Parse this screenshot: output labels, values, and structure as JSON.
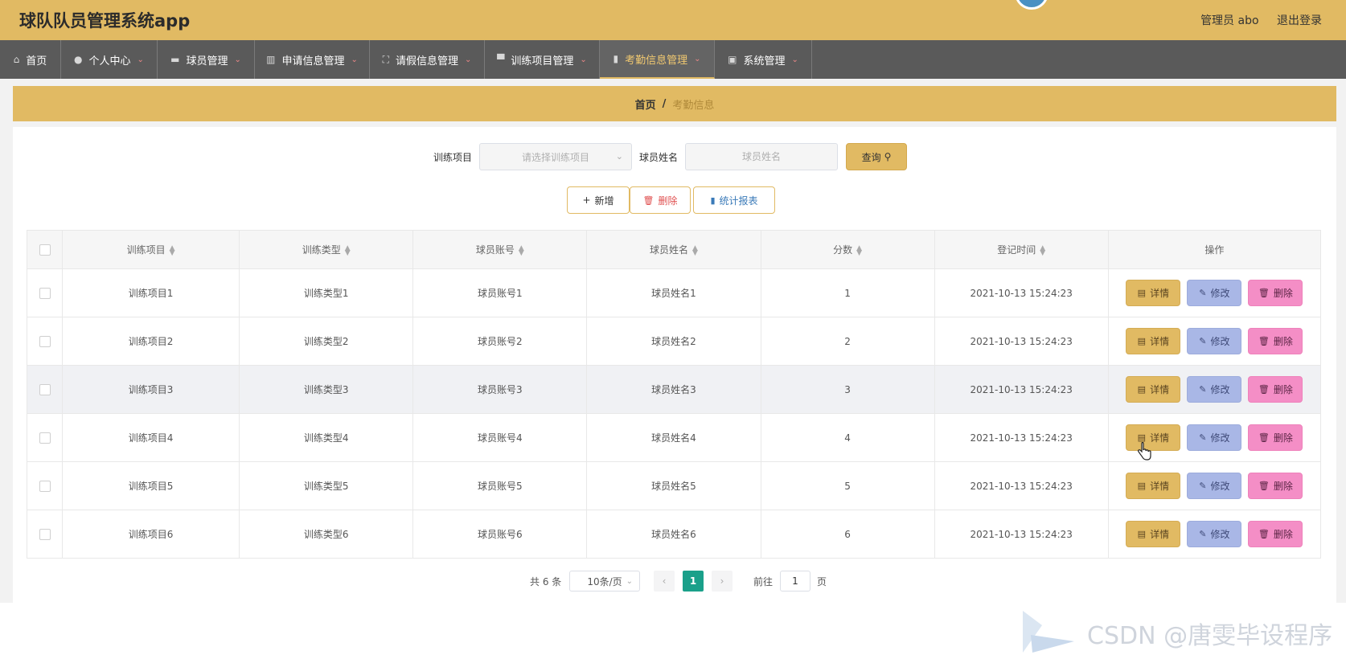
{
  "app": {
    "title": "球队队员管理系统app",
    "user": "管理员 abo",
    "logout": "退出登录"
  },
  "nav": [
    {
      "label": "首页",
      "icon": "home-icon",
      "active": false
    },
    {
      "label": "个人中心",
      "icon": "user-icon",
      "active": false
    },
    {
      "label": "球员管理",
      "icon": "player-icon",
      "active": false
    },
    {
      "label": "申请信息管理",
      "icon": "chart-icon",
      "active": false
    },
    {
      "label": "请假信息管理",
      "icon": "frame-icon",
      "active": false
    },
    {
      "label": "训练项目管理",
      "icon": "chat-icon",
      "active": false
    },
    {
      "label": "考勤信息管理",
      "icon": "bar-chart-icon",
      "active": true
    },
    {
      "label": "系统管理",
      "icon": "clipboard-icon",
      "active": false
    }
  ],
  "breadcrumb": {
    "home": "首页",
    "sep": "/",
    "current": "考勤信息"
  },
  "search": {
    "project_label": "训练项目",
    "project_placeholder": "请选择训练项目",
    "name_label": "球员姓名",
    "name_placeholder": "球员姓名",
    "query_label": "查询"
  },
  "actions": {
    "add": "新增",
    "delete": "删除",
    "report": "统计报表"
  },
  "table": {
    "headers": [
      "训练项目",
      "训练类型",
      "球员账号",
      "球员姓名",
      "分数",
      "登记时间",
      "操作"
    ],
    "rows": [
      [
        "训练项目1",
        "训练类型1",
        "球员账号1",
        "球员姓名1",
        "1",
        "2021-10-13 15:24:23"
      ],
      [
        "训练项目2",
        "训练类型2",
        "球员账号2",
        "球员姓名2",
        "2",
        "2021-10-13 15:24:23"
      ],
      [
        "训练项目3",
        "训练类型3",
        "球员账号3",
        "球员姓名3",
        "3",
        "2021-10-13 15:24:23"
      ],
      [
        "训练项目4",
        "训练类型4",
        "球员账号4",
        "球员姓名4",
        "4",
        "2021-10-13 15:24:23"
      ],
      [
        "训练项目5",
        "训练类型5",
        "球员账号5",
        "球员姓名5",
        "5",
        "2021-10-13 15:24:23"
      ],
      [
        "训练项目6",
        "训练类型6",
        "球员账号6",
        "球员姓名6",
        "6",
        "2021-10-13 15:24:23"
      ]
    ],
    "op_detail": "详情",
    "op_edit": "修改",
    "op_delete": "删除"
  },
  "pager": {
    "total": "共 6 条",
    "page_size": "10条/页",
    "current": "1",
    "goto_label": "前往",
    "goto_value": "1",
    "page_suffix": "页"
  },
  "watermark": "CSDN @唐雯毕设程序",
  "colors": {
    "accent": "#e1ba63",
    "nav_bg": "#5a5a5a",
    "pager_active": "#1aa08a"
  }
}
